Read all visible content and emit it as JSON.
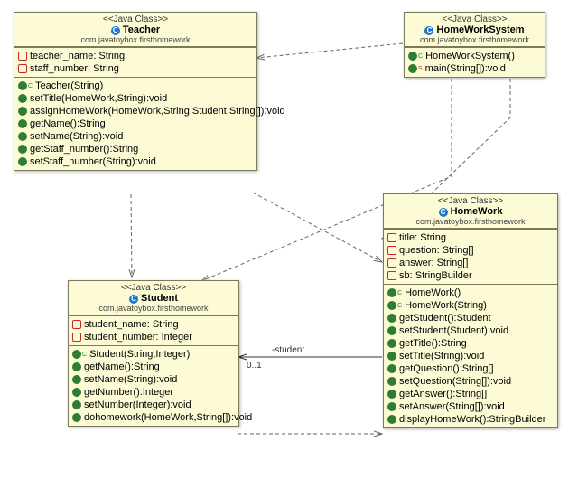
{
  "stereo": "<<Java Class>>",
  "pkg": "com.javatoybox.firsthomework",
  "teacher": {
    "name": "Teacher",
    "fields": [
      "teacher_name: String",
      "staff_number: String"
    ],
    "methods": [
      "Teacher(String)",
      "setTitle(HomeWork,String):void",
      "assignHomeWork(HomeWork,String,Student,String[]):void",
      "getName():String",
      "setName(String):void",
      "getStaff_number():String",
      "setStaff_number(String):void"
    ]
  },
  "hws": {
    "name": "HomeWorkSystem",
    "methods": [
      "HomeWorkSystem()",
      "main(String[]):void"
    ]
  },
  "student": {
    "name": "Student",
    "fields": [
      "student_name: String",
      "student_number: Integer"
    ],
    "methods": [
      "Student(String,Integer)",
      "getName():String",
      "setName(String):void",
      "getNumber():Integer",
      "setNumber(Integer):void",
      "dohomework(HomeWork,String[]):void"
    ]
  },
  "homework": {
    "name": "HomeWork",
    "fields": [
      "title: String",
      "question: String[]",
      "answer: String[]",
      "sb: StringBuilder"
    ],
    "methods": [
      "HomeWork()",
      "HomeWork(String)",
      "getStudent():Student",
      "setStudent(Student):void",
      "getTitle():String",
      "setTitle(String):void",
      "getQuestion():String[]",
      "setQuestion(String[]):void",
      "getAnswer():String[]",
      "setAnswer(String[]):void",
      "displayHomeWork():StringBuilder"
    ]
  },
  "assoc": {
    "role": "-student",
    "mult": "0..1"
  }
}
